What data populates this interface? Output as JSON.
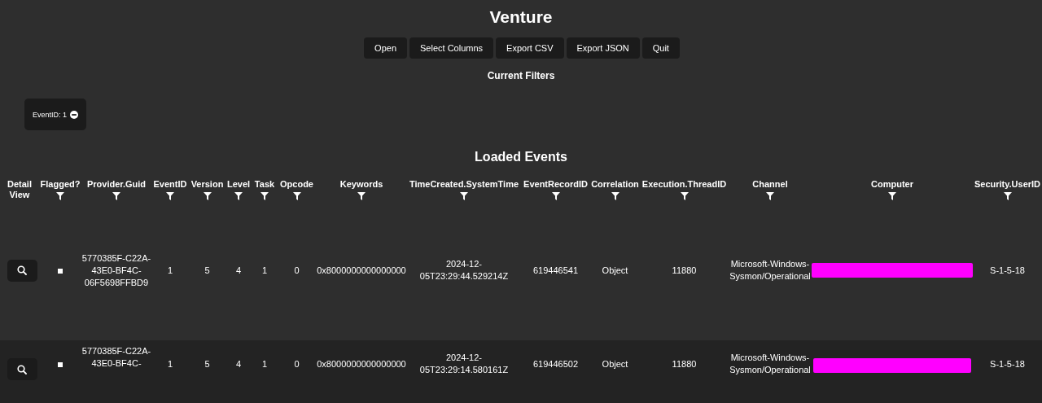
{
  "title": "Venture",
  "toolbar": [
    "Open",
    "Select Columns",
    "Export CSV",
    "Export JSON",
    "Quit"
  ],
  "filters_heading": "Current Filters",
  "filters": [
    {
      "label": "EventID: 1"
    }
  ],
  "table_heading": "Loaded Events",
  "columns": [
    "Detail View",
    "Flagged?",
    "Provider.Guid",
    "EventID",
    "Version",
    "Level",
    "Task",
    "Opcode",
    "Keywords",
    "TimeCreated.SystemTime",
    "EventRecordID",
    "Correlation",
    "Execution.ThreadID",
    "Channel",
    "Computer",
    "Security.UserID"
  ],
  "rows": [
    {
      "flagged": false,
      "cells": [
        {
          "kind": "text",
          "text": "5770385F-C22A-43E0-BF4C-06F5698FFBD9"
        },
        {
          "kind": "text",
          "text": "1"
        },
        {
          "kind": "text",
          "text": "5"
        },
        {
          "kind": "text",
          "text": "4"
        },
        {
          "kind": "text",
          "text": "1"
        },
        {
          "kind": "text",
          "text": "0"
        },
        {
          "kind": "text",
          "text": "0x8000000000000000"
        },
        {
          "kind": "text",
          "text": "2024-12-05T23:29:44.529214Z"
        },
        {
          "kind": "text",
          "text": "619446541"
        },
        {
          "kind": "text",
          "text": "Object"
        },
        {
          "kind": "text",
          "text": "11880"
        },
        {
          "kind": "text",
          "text": "Microsoft-Windows-Sysmon/Operational"
        },
        {
          "kind": "redacted"
        },
        {
          "kind": "text",
          "text": "S-1-5-18"
        }
      ]
    },
    {
      "flagged": false,
      "cells": [
        {
          "kind": "text",
          "text": "5770385F-C22A-43E0-BF4C-"
        },
        {
          "kind": "text",
          "text": "1"
        },
        {
          "kind": "text",
          "text": "5"
        },
        {
          "kind": "text",
          "text": "4"
        },
        {
          "kind": "text",
          "text": "1"
        },
        {
          "kind": "text",
          "text": "0"
        },
        {
          "kind": "text",
          "text": "0x8000000000000000"
        },
        {
          "kind": "text",
          "text": "2024-12-05T23:29:14.580161Z"
        },
        {
          "kind": "text",
          "text": "619446502"
        },
        {
          "kind": "text",
          "text": "Object"
        },
        {
          "kind": "text",
          "text": "11880"
        },
        {
          "kind": "text",
          "text": "Microsoft-Windows-Sysmon/Operational"
        },
        {
          "kind": "redacted"
        },
        {
          "kind": "text",
          "text": "S-1-5-18"
        }
      ]
    }
  ]
}
